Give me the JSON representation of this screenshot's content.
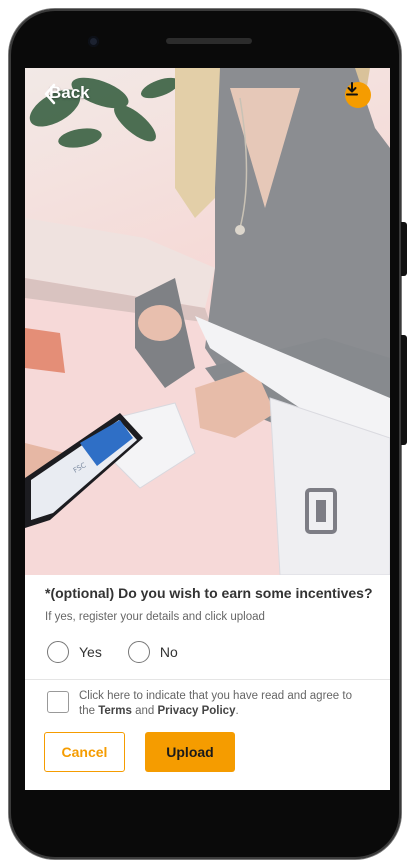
{
  "header": {
    "back_label": "Back",
    "back_icon": "chevron-left-icon",
    "download_icon": "download-icon"
  },
  "form": {
    "question": "*(optional) Do you wish to earn some incentives?",
    "hint": "If yes, register your details and click upload",
    "options": [
      "Yes",
      "No"
    ],
    "agree": {
      "prefix": "Click here to indicate that you have read and agree to the",
      "terms": "Terms",
      "conjunction": "and",
      "privacy": "Privacy Policy",
      "suffix": "."
    }
  },
  "actions": {
    "cancel_label": "Cancel",
    "upload_label": "Upload"
  },
  "colors": {
    "accent": "#f59c00"
  }
}
